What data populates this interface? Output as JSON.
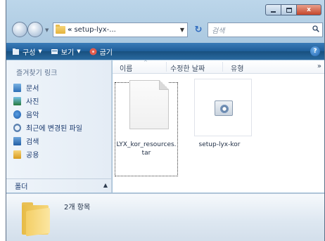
{
  "window": {
    "caption_buttons": {
      "minimize": "",
      "maximize": "",
      "close": "x"
    }
  },
  "address": {
    "chevron": "«",
    "path": "setup-lyx-...",
    "search_placeholder": "검색"
  },
  "toolbar": {
    "organize": "구성",
    "views": "보기",
    "burn": "굽기"
  },
  "nav": {
    "header": "즐겨찾기 링크",
    "items": [
      {
        "label": "문서",
        "icon": "documents-icon"
      },
      {
        "label": "사진",
        "icon": "pictures-icon"
      },
      {
        "label": "음악",
        "icon": "music-icon"
      },
      {
        "label": "최근에 변경된 파일",
        "icon": "recent-icon"
      },
      {
        "label": "검색",
        "icon": "search-folder-icon"
      },
      {
        "label": "공용",
        "icon": "public-folder-icon"
      }
    ],
    "folders_label": "폴더"
  },
  "columns": {
    "name": "이름",
    "modified": "수정한 날짜",
    "type": "유형",
    "more": "»"
  },
  "files": [
    {
      "name": "LYX_kor_resources.tar",
      "icon": "file-icon"
    },
    {
      "name": "setup-lyx-kor",
      "icon": "installer-icon"
    }
  ],
  "details": {
    "count_text": "2개 항목"
  },
  "colors": {
    "toolbar": "#1f5e99",
    "nav_text": "#1b3a6e",
    "folder": "#f4cf66"
  }
}
